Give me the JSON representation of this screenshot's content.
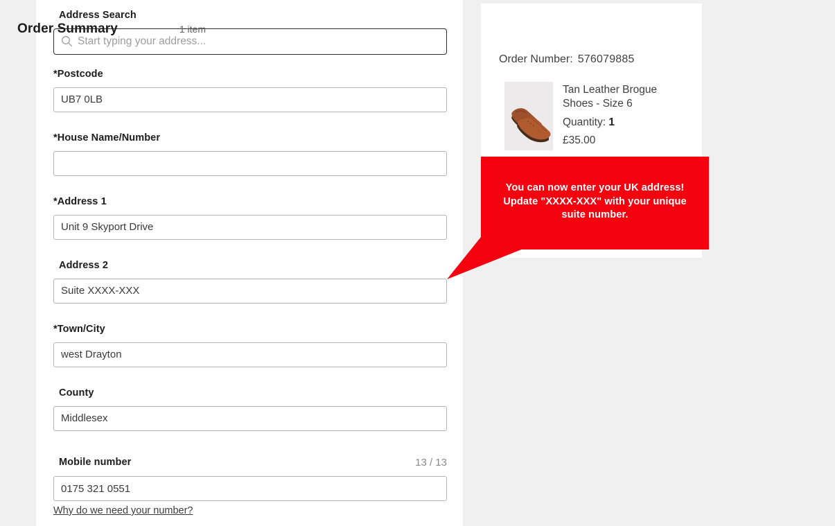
{
  "theme": {
    "page_bg": "#f0f0f0",
    "panel_bg": "#ffffff",
    "accent_red": "#f5000f",
    "label_color": "#1c1c1c",
    "input_border": "#b5b5b5",
    "search_border": "#2b2b2b"
  },
  "form": {
    "search": {
      "label": "Address Search",
      "placeholder": "Start typing your address...",
      "value": "",
      "icon": "search-icon"
    },
    "fields": [
      {
        "label": "*Postcode",
        "value": "UB7 0LB",
        "indent": false
      },
      {
        "label": "*House Name/Number",
        "value": "",
        "indent": false
      },
      {
        "label": "*Address 1",
        "value": "Unit 9 Skyport Drive",
        "indent": false
      },
      {
        "label": "Address 2",
        "value": "Suite XXXX-XXX",
        "indent": true
      },
      {
        "label": "*Town/City",
        "value": "west Drayton",
        "indent": false
      },
      {
        "label": "County",
        "value": "Middlesex",
        "indent": true
      }
    ],
    "mobile": {
      "label": "Mobile number",
      "counter": "13 / 13",
      "value": "0175 321 0551",
      "help_link": "Why do we need your number?"
    }
  },
  "summary": {
    "title": "Order Summary",
    "item_count": "1 item",
    "order_number_label": "Order Number:",
    "order_number": "576079885",
    "product": {
      "name": "Tan Leather Brogue Shoes - Size 6",
      "quantity_label": "Quantity:",
      "quantity": "1",
      "price": "£35.00",
      "image_alt": "tan-leather-brogue-shoes"
    }
  },
  "callout": {
    "line1": "You can now enter your UK address!",
    "line2": "Update \"XXXX-XXX\" with your unique",
    "line3": "suite number."
  }
}
